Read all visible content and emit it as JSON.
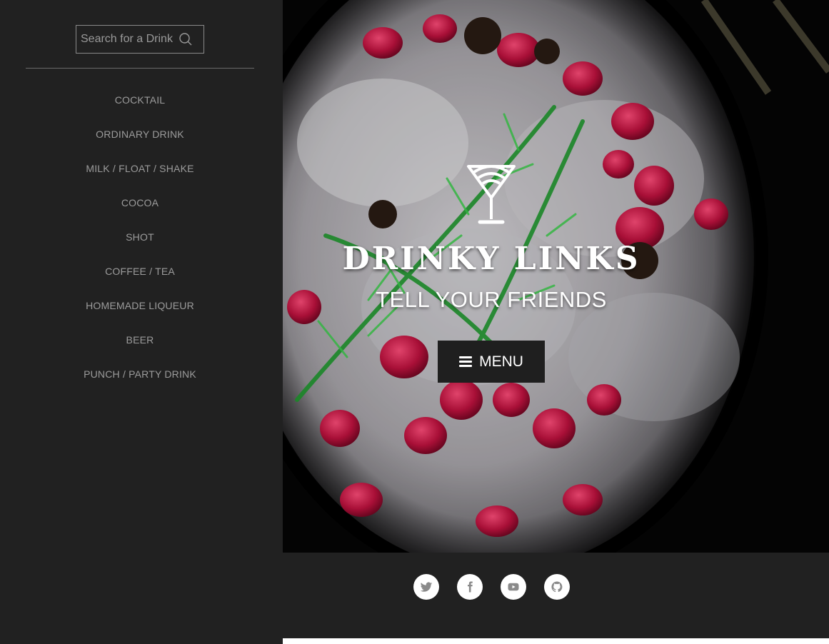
{
  "search": {
    "placeholder": "Search for a Drink"
  },
  "sidebar": {
    "items": [
      {
        "label": "COCKTAIL"
      },
      {
        "label": "ORDINARY DRINK"
      },
      {
        "label": "MILK / FLOAT / SHAKE"
      },
      {
        "label": "COCOA"
      },
      {
        "label": "SHOT"
      },
      {
        "label": "COFFEE / TEA"
      },
      {
        "label": "HOMEMADE LIQUEUR"
      },
      {
        "label": "BEER"
      },
      {
        "label": "PUNCH / PARTY DRINK"
      }
    ]
  },
  "hero": {
    "brand": "DRINKY LINKS",
    "tagline": "TELL YOUR FRIENDS",
    "menu_label": "MENU",
    "logo_icon": "cocktail-glass-icon"
  },
  "footer": {
    "social": [
      {
        "icon": "twitter-icon"
      },
      {
        "icon": "facebook-icon"
      },
      {
        "icon": "youtube-icon"
      },
      {
        "icon": "github-icon"
      }
    ]
  },
  "colors": {
    "sidebar_bg": "#212121",
    "nav_text": "#9c9c9c",
    "menu_button_bg": "#1f1f1f",
    "accent_pomegranate": "#b0123c"
  }
}
